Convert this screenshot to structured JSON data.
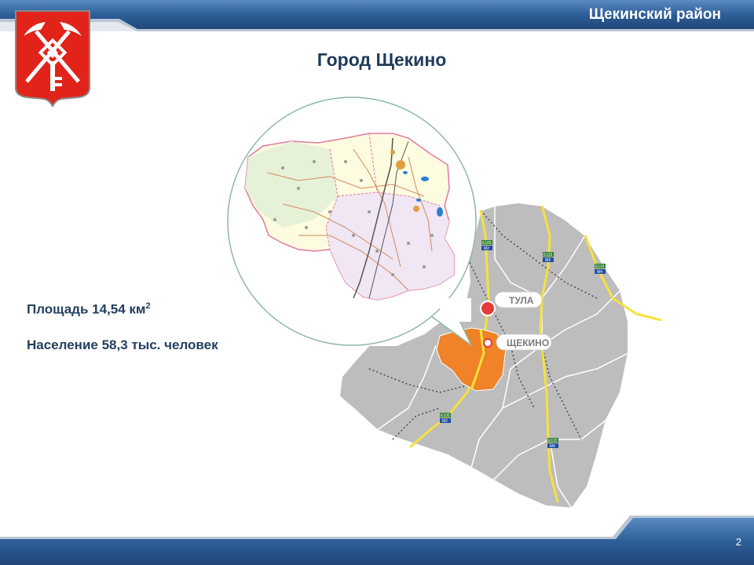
{
  "header": {
    "region": "Щекинский район"
  },
  "title": "Город Щекино",
  "stats": {
    "area_label": "Площадь 14,54 км",
    "area_sup": "2",
    "population": "Население 58,3 тыс. человек"
  },
  "map": {
    "city_tula": "ТУЛА",
    "city_shchekino": "ЩЕКИНО",
    "road_labels": [
      "E105",
      "M2",
      "E115",
      "M4",
      "E119",
      "M4",
      "E105",
      "M2",
      "E115",
      "M4"
    ]
  },
  "footer": {
    "page_number": "2"
  },
  "colors": {
    "header_blue": "#2c5d96",
    "title_navy": "#1f3b5c",
    "district_orange": "#f08227",
    "region_gray": "#bdbdbd",
    "city_red": "#e43a3a",
    "coat_red": "#e2231a"
  }
}
